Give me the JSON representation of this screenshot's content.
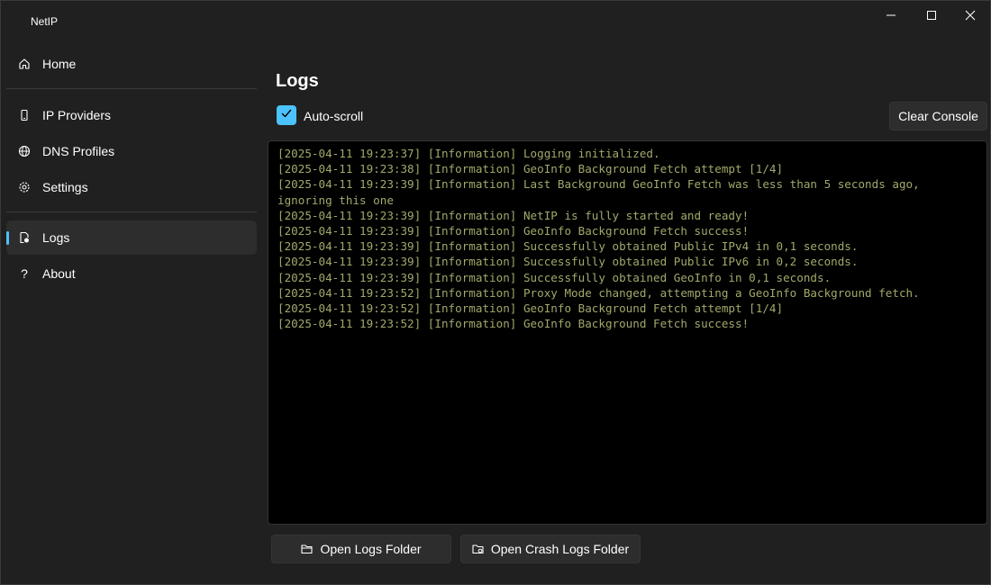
{
  "window": {
    "title": "NetIP",
    "controls": {
      "minimize_icon": "minimize-icon",
      "maximize_icon": "maximize-icon",
      "close_icon": "close-icon"
    }
  },
  "sidebar": {
    "items": [
      {
        "label": "Home",
        "icon": "home-icon",
        "selected": false
      },
      {
        "label": "IP Providers",
        "icon": "phone-icon",
        "selected": false
      },
      {
        "label": "DNS Profiles",
        "icon": "globe-icon",
        "selected": false
      },
      {
        "label": "Settings",
        "icon": "gear-icon",
        "selected": false
      },
      {
        "label": "Logs",
        "icon": "logs-icon",
        "selected": true
      },
      {
        "label": "About",
        "icon": "question-icon",
        "selected": false
      }
    ]
  },
  "main": {
    "title": "Logs",
    "auto_scroll": {
      "label": "Auto-scroll",
      "checked": true
    },
    "clear_button": "Clear Console",
    "open_logs_button": "Open Logs Folder",
    "open_crash_button": "Open Crash Logs Folder",
    "log_lines": [
      "[2025-04-11 19:23:37] [Information] Logging initialized.",
      "[2025-04-11 19:23:38] [Information] GeoInfo Background Fetch attempt [1/4]",
      "[2025-04-11 19:23:39] [Information] Last Background GeoInfo Fetch was less than 5 seconds ago,\nignoring this one",
      "[2025-04-11 19:23:39] [Information] NetIP is fully started and ready!",
      "[2025-04-11 19:23:39] [Information] GeoInfo Background Fetch success!",
      "[2025-04-11 19:23:39] [Information] Successfully obtained Public IPv4 in 0,1 seconds.",
      "[2025-04-11 19:23:39] [Information] Successfully obtained Public IPv6 in 0,2 seconds.",
      "[2025-04-11 19:23:39] [Information] Successfully obtained GeoInfo in 0,1 seconds.",
      "[2025-04-11 19:23:52] [Information] Proxy Mode changed, attempting a GeoInfo Background fetch.",
      "[2025-04-11 19:23:52] [Information] GeoInfo Background Fetch attempt [1/4]",
      "[2025-04-11 19:23:52] [Information] GeoInfo Background Fetch success!"
    ]
  },
  "colors": {
    "accent": "#4cc2ff",
    "background": "#202020",
    "console_text": "#a3a86a"
  }
}
